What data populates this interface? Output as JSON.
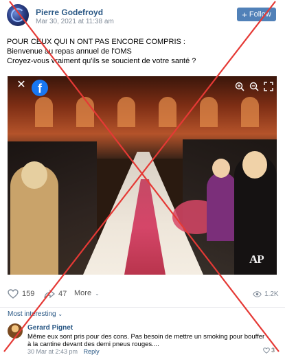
{
  "post": {
    "author": "Pierre Godefroyd",
    "date": "Mar 30, 2021 at 11:38 am",
    "follow_label": "Follow",
    "text_lines": [
      "POUR CEUX QUI N ONT PAS ENCORE COMPRIS :",
      "Bienvenue au repas annuel de l'OMS",
      "Croyez-vous vraiment qu'ils se soucient de votre santé ?"
    ]
  },
  "photo": {
    "watermark": "AP",
    "icons": [
      "close-icon",
      "facebook-icon",
      "zoom-in-icon",
      "zoom-out-icon",
      "fullscreen-icon"
    ]
  },
  "actions": {
    "likes": "159",
    "shares": "47",
    "more_label": "More",
    "views": "1.2K"
  },
  "comments": {
    "sort_label": "Most interesting",
    "items": [
      {
        "author": "Gerard Pignet",
        "text": "Même eux sont pris pour des cons. Pas besoin de mettre un smoking pour bouffer à la cantine devant des demi pneus rouges....",
        "date": "30 Mar at 2:43 pm",
        "reply_label": "Reply",
        "likes": "3"
      }
    ]
  },
  "colors": {
    "link": "#2a5885",
    "button": "#5181b8",
    "cross": "#e53935",
    "muted": "#818c99"
  }
}
